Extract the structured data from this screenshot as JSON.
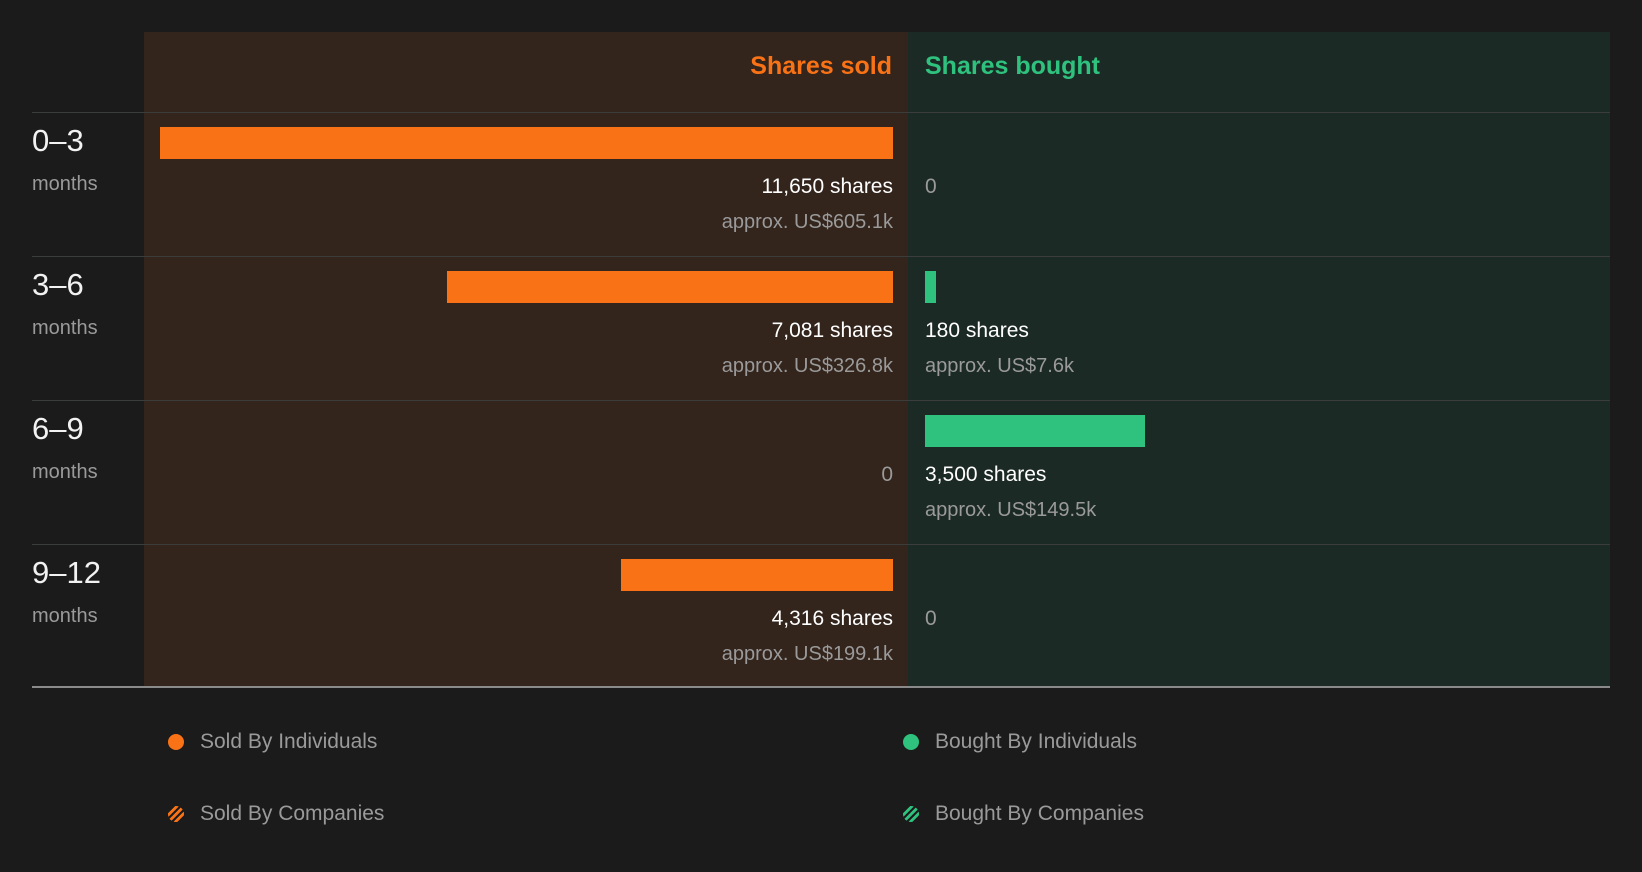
{
  "colors": {
    "sold": "#f97316",
    "bought": "#2ec27e",
    "sold_bg": "#33241c",
    "bought_bg": "#1c2a25"
  },
  "chart_data": {
    "type": "bar",
    "orientation": "horizontal-diverging",
    "columns": {
      "sold": "Shares sold",
      "bought": "Shares bought"
    },
    "categories": [
      {
        "range": "0–3",
        "unit": "months"
      },
      {
        "range": "3–6",
        "unit": "months"
      },
      {
        "range": "6–9",
        "unit": "months"
      },
      {
        "range": "9–12",
        "unit": "months"
      }
    ],
    "series": [
      {
        "side": "sold",
        "values": [
          11650,
          7081,
          0,
          4316
        ],
        "share_labels": [
          "11,650 shares",
          "7,081 shares",
          "0",
          "4,316 shares"
        ],
        "value_labels": [
          "approx. US$605.1k",
          "approx. US$326.8k",
          "",
          "approx. US$199.1k"
        ]
      },
      {
        "side": "bought",
        "values": [
          0,
          180,
          3500,
          0
        ],
        "share_labels": [
          "0",
          "180 shares",
          "3,500 shares",
          "0"
        ],
        "value_labels": [
          "",
          "approx. US$7.6k",
          "approx. US$149.5k",
          ""
        ]
      }
    ],
    "legend": [
      {
        "label": "Sold By Individuals",
        "style": "solid",
        "side": "sold"
      },
      {
        "label": "Bought By Individuals",
        "style": "solid",
        "side": "bought"
      },
      {
        "label": "Sold By Companies",
        "style": "hatched",
        "side": "sold"
      },
      {
        "label": "Bought By Companies",
        "style": "hatched",
        "side": "bought"
      }
    ]
  }
}
